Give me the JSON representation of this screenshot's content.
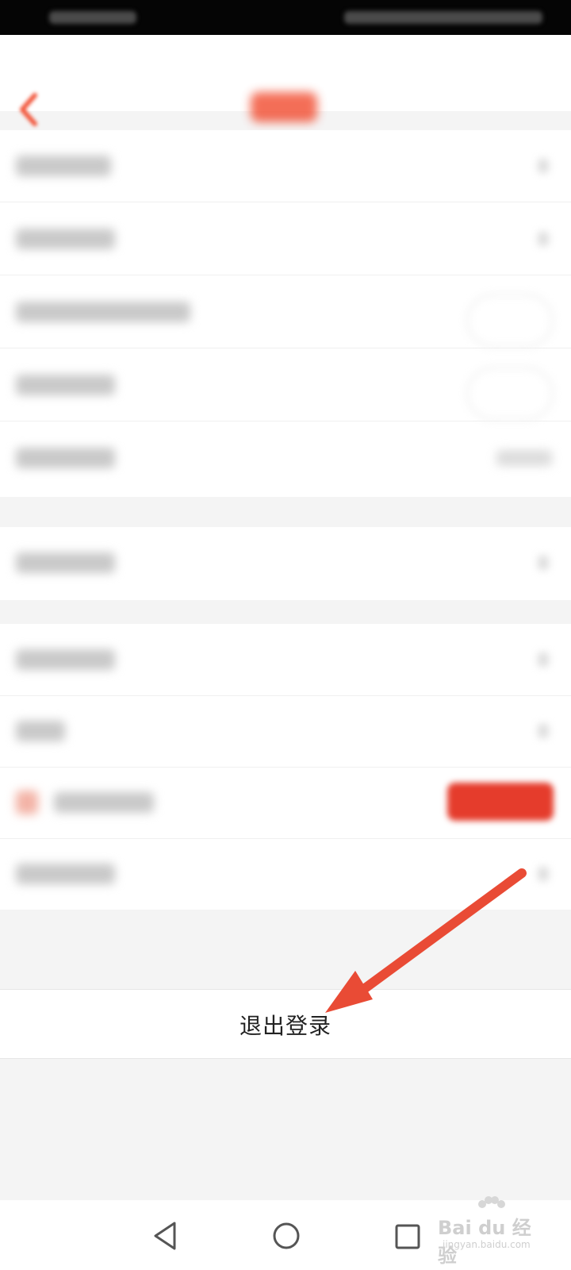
{
  "logout": {
    "label": "退出登录"
  },
  "watermark": {
    "brand": "Bai du 经验",
    "url": "jingyan.baidu.com"
  },
  "colors": {
    "accent": "#f2553a",
    "arrow": "#e94b35",
    "danger": "#e53c2c"
  },
  "icons": [
    "back-icon",
    "triangle-back-icon",
    "circle-home-icon",
    "square-recents-icon",
    "watermark-logo-icon"
  ]
}
